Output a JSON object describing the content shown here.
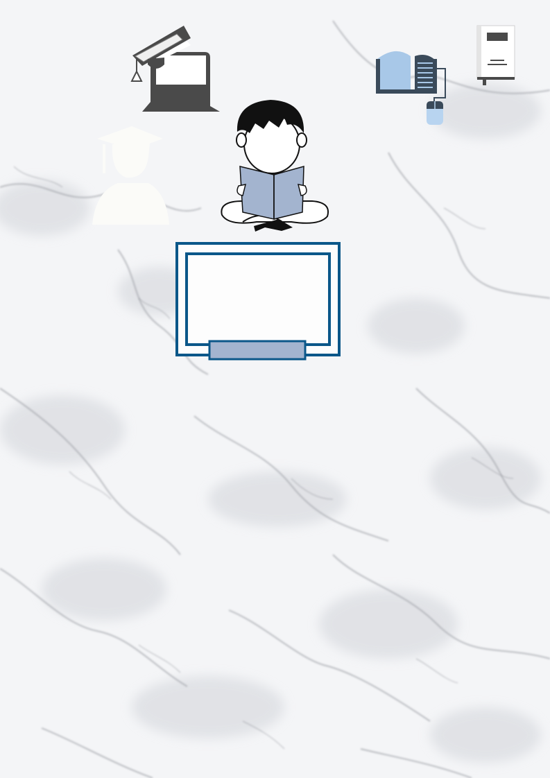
{
  "page": {
    "background": "#f3f4f6",
    "marble_vein_color": "#9a9ca3"
  },
  "colors": {
    "frame_outer": "#0b5789",
    "frame_fill": "#fdfdfd",
    "label_bar": "#a3b4cf",
    "laptop": "#4a4a4a",
    "book_blue": "#a8c8e8",
    "book_dark": "#3a4a5a",
    "mouse": "#b8d4f0",
    "boy_book": "#a3b4cf",
    "hair": "#111111",
    "silhouette": "#fbfbf8"
  },
  "icons": {
    "laptop_cap": "graduation-laptop-icon",
    "open_book": "open-book-icon",
    "mouse": "computer-mouse-icon",
    "closed_book": "closed-book-icon",
    "graduate": "graduate-silhouette-icon",
    "reading_boy": "reading-child-illustration"
  },
  "frame": {
    "title": "",
    "label": ""
  }
}
